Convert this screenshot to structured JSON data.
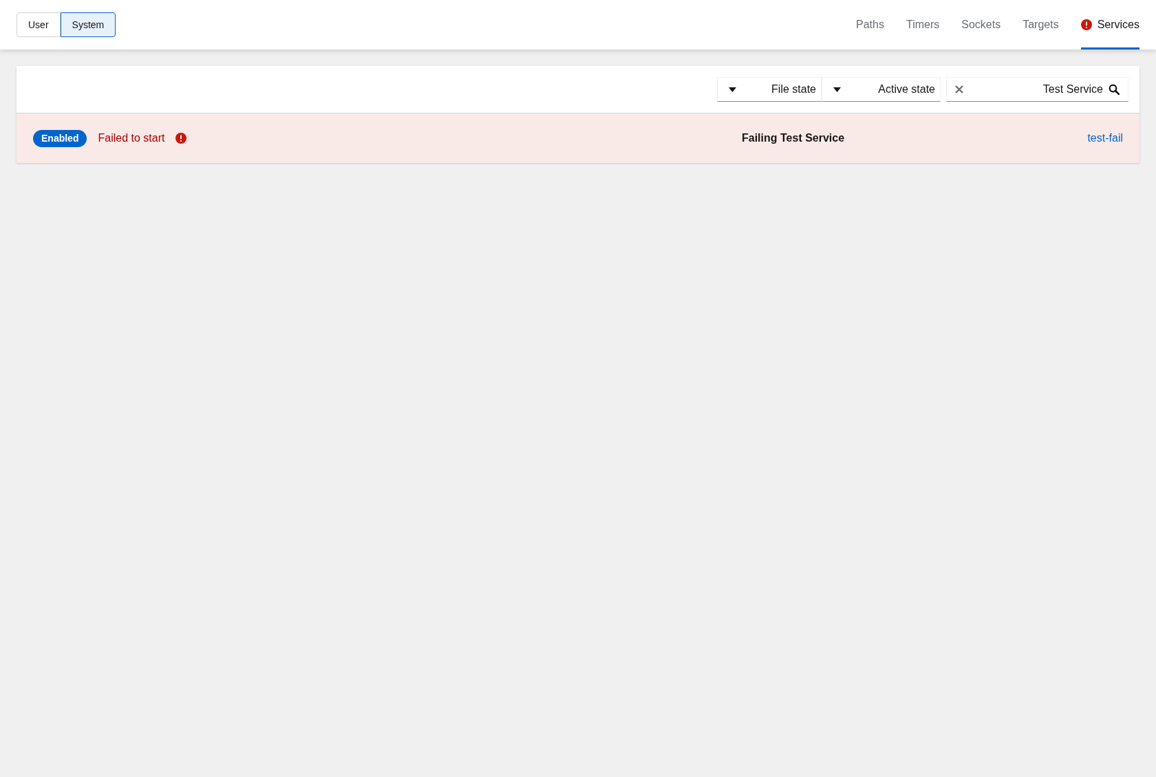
{
  "scope_toggle": [
    {
      "label": "User",
      "selected": false
    },
    {
      "label": "System",
      "selected": true
    }
  ],
  "tabs": [
    {
      "label": "Paths",
      "selected": false,
      "alert": false
    },
    {
      "label": "Timers",
      "selected": false,
      "alert": false
    },
    {
      "label": "Sockets",
      "selected": false,
      "alert": false
    },
    {
      "label": "Targets",
      "selected": false,
      "alert": false
    },
    {
      "label": "Services",
      "selected": true,
      "alert": true
    }
  ],
  "filters": [
    {
      "label": "File state"
    },
    {
      "label": "Active state"
    }
  ],
  "search": {
    "value": "Test Service"
  },
  "rows": [
    {
      "badge": "Enabled",
      "status": "Failed to start",
      "failed": true,
      "description": "Failing Test Service",
      "unit": "test-fail"
    }
  ]
}
